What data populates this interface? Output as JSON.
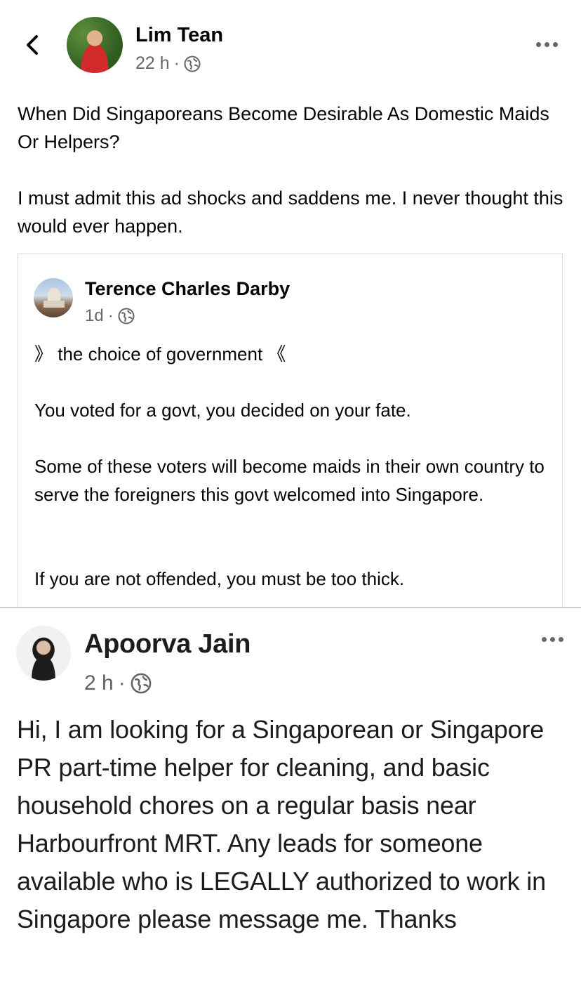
{
  "post": {
    "author": "Lim Tean",
    "time": "22 h",
    "separator": "·",
    "paragraphs": [
      "When Did Singaporeans Become Desirable As Domestic Maids Or Helpers?",
      "I must admit this ad shocks and saddens me. I never thought this would ever happen."
    ]
  },
  "shared": {
    "author": "Terence Charles Darby",
    "time": "1d",
    "separator": "·",
    "paragraphs": [
      "》 the choice of government 《",
      "You voted for a govt, you decided on your fate.",
      "Some of these voters will become maids in their own country to serve the foreigners this govt welcomed into Singapore.",
      "If you are not offended, you must be too thick."
    ]
  },
  "ad_post": {
    "author": "Apoorva Jain",
    "time": "2 h",
    "separator": "·",
    "body": "Hi, I am looking for a Singaporean or Singapore PR part-time helper for cleaning, and basic household chores on a regular basis near Harbourfront MRT. Any leads for someone available who is LEGALLY authorized to work in Singapore please message me. Thanks"
  }
}
